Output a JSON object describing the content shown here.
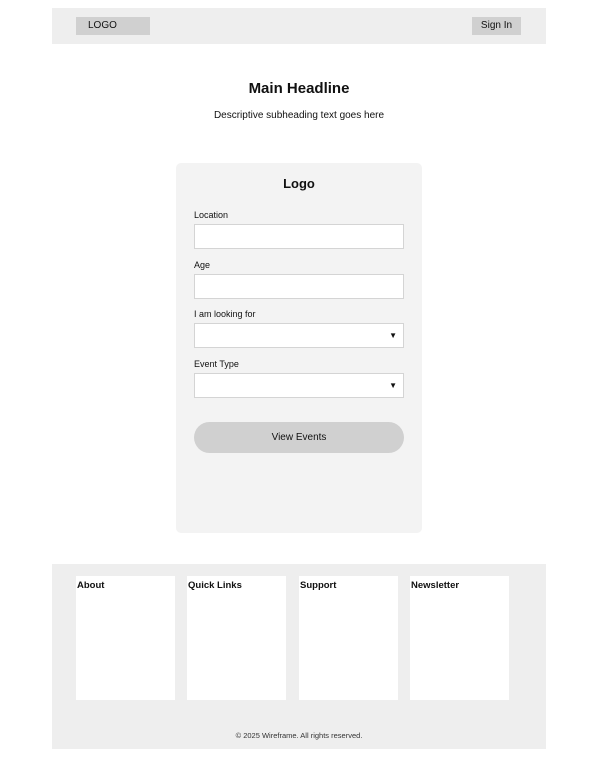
{
  "header": {
    "logo": "LOGO",
    "sign_in": "Sign In"
  },
  "hero": {
    "title": "Main Headline",
    "subtitle": "Descriptive subheading text goes here"
  },
  "form": {
    "title": "Logo",
    "fields": [
      {
        "label": "Location",
        "type": "text",
        "value": ""
      },
      {
        "label": "Age",
        "type": "text",
        "value": ""
      },
      {
        "label": "I am looking for",
        "type": "select",
        "value": ""
      },
      {
        "label": "Event Type",
        "type": "select",
        "value": ""
      }
    ],
    "submit": "View Events",
    "select_arrow": "▼"
  },
  "footer": {
    "columns": [
      {
        "title": "About"
      },
      {
        "title": "Quick Links"
      },
      {
        "title": "Support"
      },
      {
        "title": "Newsletter"
      }
    ],
    "copyright": "© 2025 Wireframe. All rights reserved."
  }
}
